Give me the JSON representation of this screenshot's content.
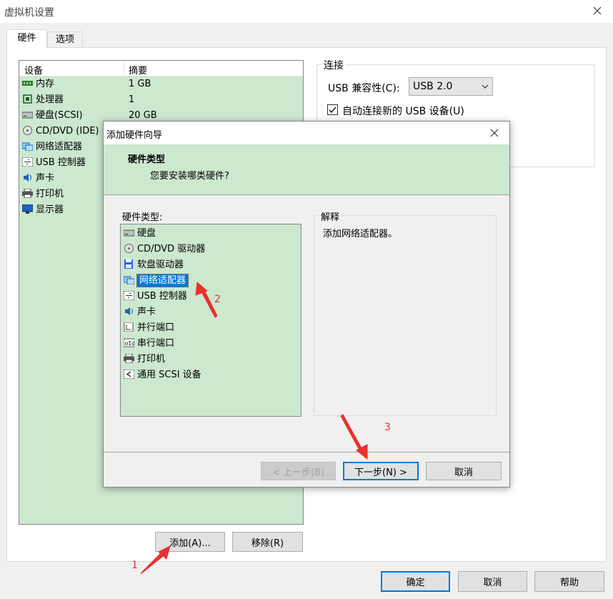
{
  "window": {
    "title": "虚拟机设置"
  },
  "tabs": [
    {
      "label": "硬件"
    },
    {
      "label": "选项"
    }
  ],
  "device_table": {
    "col_device": "设备",
    "col_summary": "摘要",
    "rows": [
      {
        "device": "内存",
        "summary": "1 GB",
        "icon": "memory-icon"
      },
      {
        "device": "处理器",
        "summary": "1",
        "icon": "processor-icon"
      },
      {
        "device": "硬盘(SCSI)",
        "summary": "20 GB",
        "icon": "hard-disk-icon"
      },
      {
        "device": "CD/DVD (IDE)",
        "summary": "",
        "icon": "cd-dvd-icon"
      },
      {
        "device": "网络适配器",
        "summary": "",
        "icon": "network-adapter-icon"
      },
      {
        "device": "USB 控制器",
        "summary": "",
        "icon": "usb-icon"
      },
      {
        "device": "声卡",
        "summary": "",
        "icon": "sound-card-icon"
      },
      {
        "device": "打印机",
        "summary": "",
        "icon": "printer-icon"
      },
      {
        "device": "显示器",
        "summary": "",
        "icon": "display-icon"
      }
    ]
  },
  "connection": {
    "group_label": "连接",
    "usb_compat_label": "USB 兼容性(C):",
    "usb_compat_value": "USB 2.0",
    "auto_connect_label": "自动连接新的 USB 设备(U)",
    "auto_connect_checked": true
  },
  "bottom_buttons": {
    "add": "添加(A)...",
    "remove": "移除(R)",
    "ok": "确定",
    "cancel": "取消",
    "help": "帮助"
  },
  "wizard": {
    "title": "添加硬件向导",
    "header_title": "硬件类型",
    "header_subtitle": "您要安装哪类硬件?",
    "list_label": "硬件类型:",
    "items": [
      {
        "label": "硬盘",
        "icon": "hard-disk-icon"
      },
      {
        "label": "CD/DVD 驱动器",
        "icon": "cd-dvd-icon"
      },
      {
        "label": "软盘驱动器",
        "icon": "floppy-icon"
      },
      {
        "label": "网络适配器",
        "icon": "network-adapter-icon",
        "selected": true
      },
      {
        "label": "USB 控制器",
        "icon": "usb-icon"
      },
      {
        "label": "声卡",
        "icon": "sound-card-icon"
      },
      {
        "label": "并行端口",
        "icon": "parallel-port-icon"
      },
      {
        "label": "串行端口",
        "icon": "serial-port-icon"
      },
      {
        "label": "打印机",
        "icon": "printer-icon"
      },
      {
        "label": "通用 SCSI 设备",
        "icon": "scsi-icon"
      }
    ],
    "explanation_label": "解释",
    "explanation_text": "添加网络适配器。",
    "back_button": "< 上一步(B)",
    "next_button": "下一步(N) >",
    "cancel_button": "取消"
  },
  "annotations": [
    {
      "label": "1"
    },
    {
      "label": "2"
    },
    {
      "label": "3"
    }
  ],
  "colors": {
    "list_bg": "#cce8cf",
    "selected_bg": "#0078d7",
    "arrow_red": "#e8312f",
    "header_bg": "#cce8cf"
  }
}
